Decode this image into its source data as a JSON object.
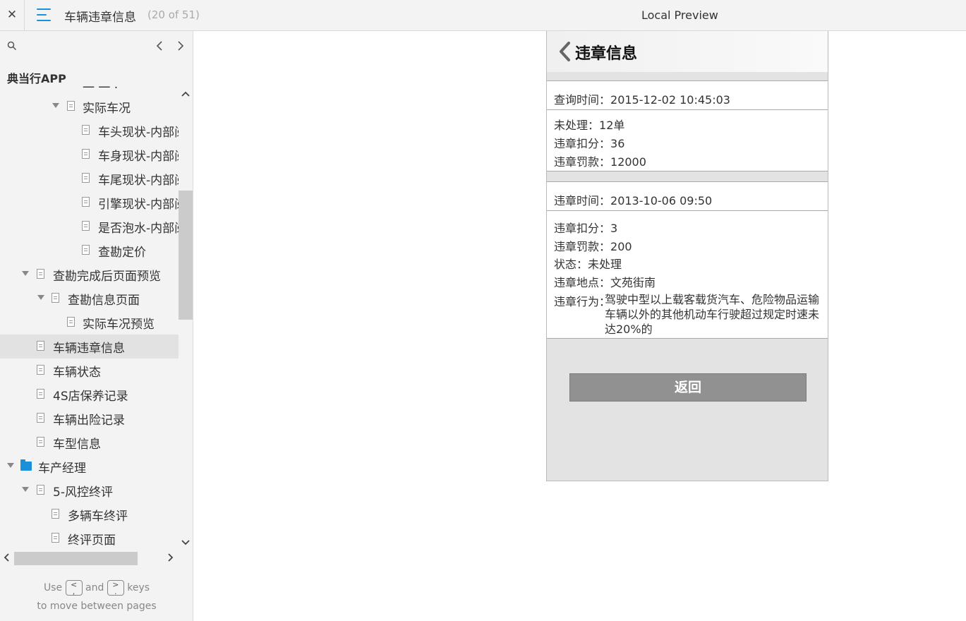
{
  "topbar": {
    "close_label": "✕",
    "title": "车辆违章信息",
    "page_count": "(20 of 51)",
    "preview_title": "Local Preview"
  },
  "sidebar": {
    "project_name": "典当行APP",
    "partial_top": "一 一 ·",
    "items": [
      {
        "label": "实际车况"
      },
      {
        "label": "车头现状-内部阅"
      },
      {
        "label": "车身现状-内部阅"
      },
      {
        "label": "车尾现状-内部阅"
      },
      {
        "label": "引擎现状-内部阅"
      },
      {
        "label": "是否泡水-内部阅"
      },
      {
        "label": "查勘定价"
      },
      {
        "label": "查勘完成后页面预览"
      },
      {
        "label": "查勘信息页面"
      },
      {
        "label": "实际车况预览"
      },
      {
        "label": "车辆违章信息"
      },
      {
        "label": "车辆状态"
      },
      {
        "label": "4S店保养记录"
      },
      {
        "label": "车辆出险记录"
      },
      {
        "label": "车型信息"
      },
      {
        "label": "车产经理"
      },
      {
        "label": "5-风控终评"
      },
      {
        "label": "多辆车终评"
      },
      {
        "label": "终评页面"
      }
    ],
    "hint_use": "Use",
    "hint_and": "and",
    "hint_keys": "keys",
    "hint_line2": "to move between pages",
    "key_prev": "<\n,",
    "key_next": ">\n."
  },
  "preview": {
    "title": "违章信息",
    "query_time_label": "查询时间：",
    "query_time": "2015-12-02 10:45:03",
    "unprocessed_label": "未处理：",
    "unprocessed": "12单",
    "points_label": "违章扣分：",
    "points_total": "36",
    "fine_label": "违章罚款：",
    "fine_total": "12000",
    "violation_time_label": "违章时间：",
    "violation_time": "2013-10-06 09:50",
    "v_points": "3",
    "v_fine": "200",
    "status_label": "状态：",
    "status": "未处理",
    "location_label": "违章地点：",
    "location": "文苑街南",
    "behavior_label": "违章行为：",
    "behavior": "驾驶中型以上载客载货汽车、危险物品运输车辆以外的其他机动车行驶超过规定时速未达20%的",
    "return_label": "返回"
  }
}
